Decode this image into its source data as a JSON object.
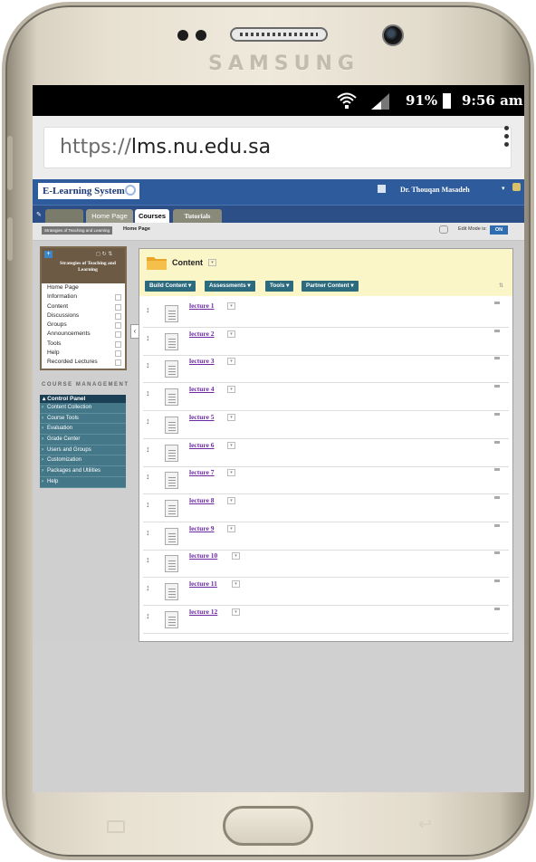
{
  "device": {
    "brand": "SAMSUNG"
  },
  "status_bar": {
    "wifi_icon": "wifi-icon",
    "battery": "91%",
    "time": "9:56 am"
  },
  "browser": {
    "url_scheme": "https://",
    "url_host": "lms.nu.edu.sa"
  },
  "lms": {
    "system_name": "E-Learning System",
    "user_name": "Dr. Thouqan Masadeh",
    "tabs": [
      "Home Page",
      "Courses",
      "Tutorials"
    ],
    "breadcrumb": [
      "Strategies of Teaching and Learning",
      "Home Page"
    ],
    "edit_mode_label": "Edit Mode is:",
    "edit_mode_value": "ON",
    "course_title": "Strategies of Teaching and Learning",
    "course_menu": [
      "Home Page",
      "Information",
      "Content",
      "Discussions",
      "Groups",
      "Announcements",
      "Tools",
      "Help",
      "Recorded Lectures"
    ],
    "course_management_title": "COURSE MANAGEMENT",
    "control_panel": {
      "title": "Control Panel",
      "items": [
        "Content Collection",
        "Course Tools",
        "Evaluation",
        "Grade Center",
        "Users and Groups",
        "Customization",
        "Packages and Utilities",
        "Help"
      ]
    },
    "content": {
      "title": "Content",
      "actions": [
        "Build Content",
        "Assessments",
        "Tools",
        "Partner Content"
      ],
      "lectures": [
        "lecture 1",
        "lecture 2",
        "lecture 3",
        "lecture 4",
        "lecture 5",
        "lecture 6",
        "lecture 7",
        "lecture 8",
        "lecture 9",
        "lecture 10",
        "lecture 11",
        "lecture 12"
      ]
    }
  }
}
